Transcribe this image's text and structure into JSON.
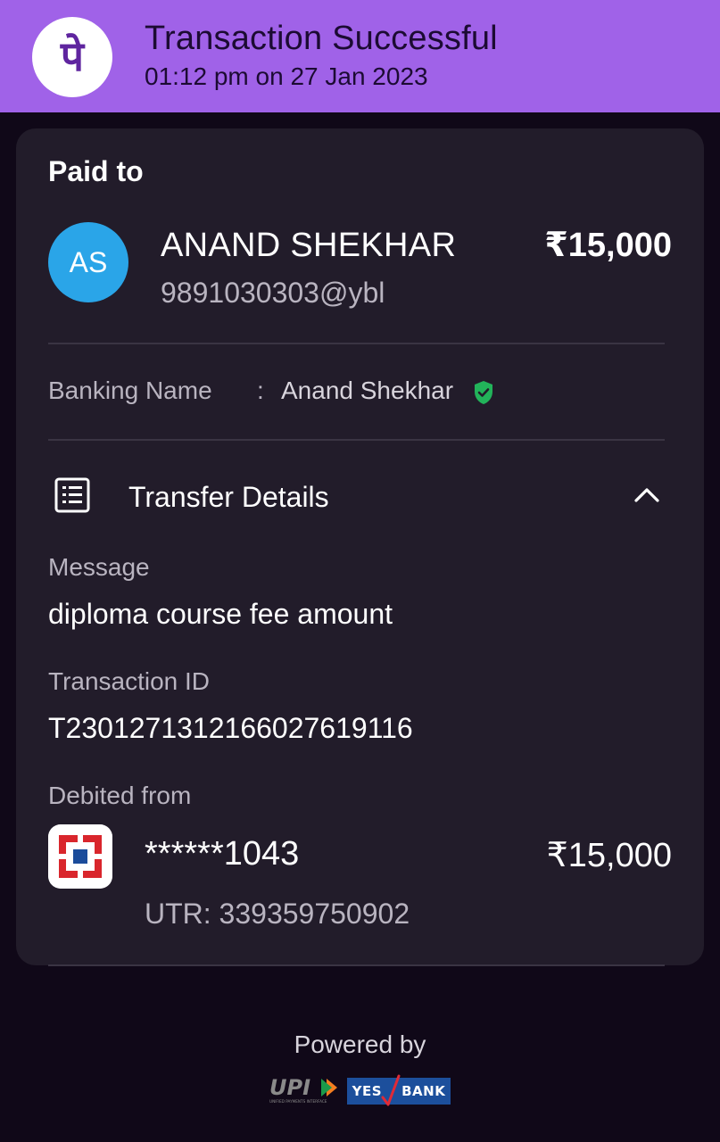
{
  "header": {
    "title": "Transaction Successful",
    "datetime": "01:12 pm on 27 Jan 2023",
    "logo_glyph": "पे",
    "logo_icon": "phonepe-logo-icon",
    "accent_color": "#a062e8"
  },
  "payee": {
    "section_label": "Paid to",
    "avatar_initials": "AS",
    "name": "ANAND SHEKHAR",
    "upi_id": "9891030303@ybl",
    "amount": "₹15,000"
  },
  "banking": {
    "label": "Banking Name",
    "separator": ":",
    "value": "Anand Shekhar",
    "verified_icon": "shield-check-icon"
  },
  "transfer_details": {
    "title": "Transfer Details",
    "icon": "receipt-list-icon",
    "toggle_icon": "chevron-up-icon",
    "message_label": "Message",
    "message_value": "diploma course fee amount",
    "txn_label": "Transaction ID",
    "txn_value": "T2301271312166027619116",
    "debited_label": "Debited from",
    "bank_icon": "hdfc-bank-icon",
    "account_masked": "******1043",
    "debited_amount": "₹15,000",
    "utr": "UTR: 339359750902"
  },
  "footer": {
    "powered_by": "Powered by",
    "upi_text": "UPI",
    "upi_subtext": "UNIFIED PAYMENTS INTERFACE",
    "bank_left": "YES",
    "bank_right": "BANK"
  }
}
